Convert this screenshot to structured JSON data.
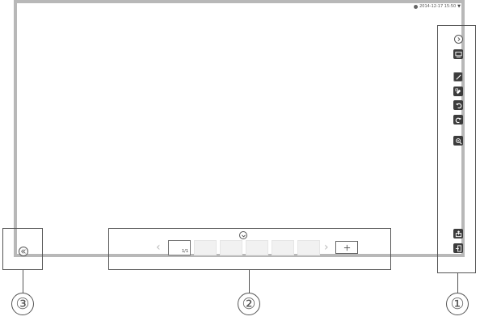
{
  "status_bar": {
    "datetime": "2014-12-17 15:50",
    "dropdown_glyph": "▼"
  },
  "toolbar": {
    "icons": [
      "chevron-right-icon",
      "display-icon",
      "pen-icon",
      "eraser-icon",
      "undo-icon",
      "redo-icon",
      "zoom-in-icon",
      "export-icon",
      "exit-icon"
    ]
  },
  "pages": {
    "current_label": "1/1",
    "prev_glyph": "‹",
    "next_glyph": "›"
  },
  "callouts": {
    "one": "①",
    "two": "②",
    "three": "③"
  }
}
